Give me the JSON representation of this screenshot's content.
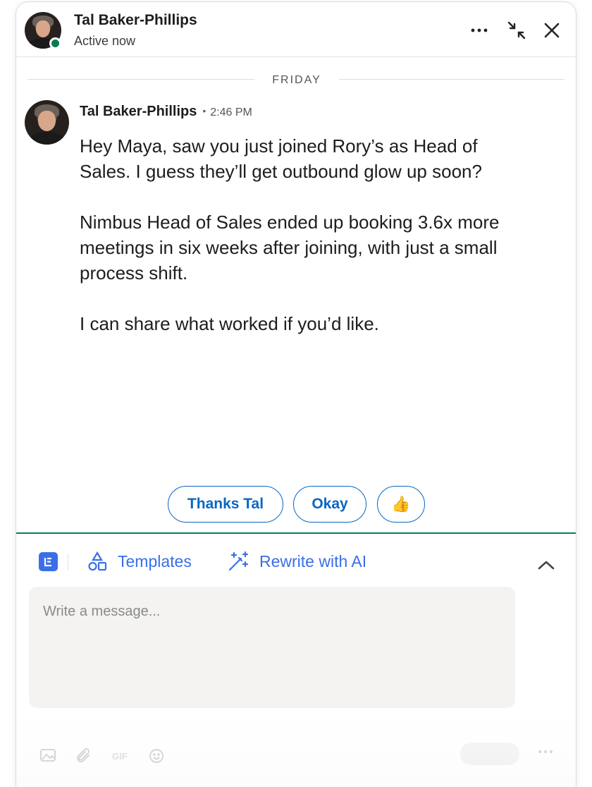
{
  "header": {
    "name": "Tal Baker-Phillips",
    "status": "Active now",
    "presence_color": "#0a7b4f",
    "icons": [
      "more-icon",
      "minimize-icon",
      "close-icon"
    ]
  },
  "conversation": {
    "date_separator": "FRIDAY",
    "message": {
      "sender": "Tal Baker-Phillips",
      "separator": "•",
      "time": "2:46 PM",
      "paragraphs": [
        "Hey Maya, saw you just joined Rory’s as Head of Sales. I guess they’ll get outbound glow up soon?",
        "Nimbus Head of Sales ended up booking 3.6x more meetings in six weeks after joining, with just a small process shift.",
        "I can share what worked if you’d like."
      ]
    }
  },
  "quick_replies": [
    "Thanks Tal",
    "Okay",
    "👍"
  ],
  "composer": {
    "templates_label": "Templates",
    "rewrite_label": "Rewrite with AI",
    "placeholder": "Write a message...",
    "gif_label": "GIF",
    "accent_color": "#3a6fe8",
    "divider_color": "#0a7b4f"
  }
}
